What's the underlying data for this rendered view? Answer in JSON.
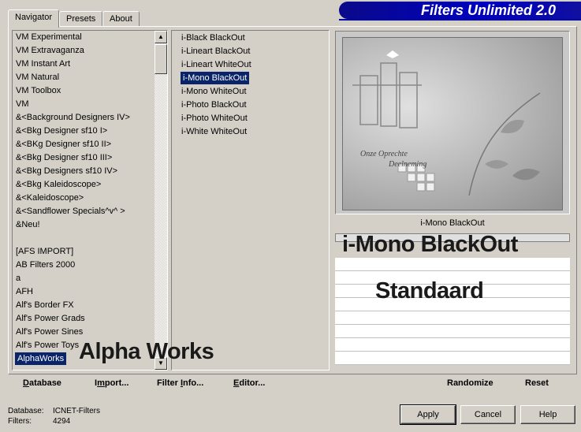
{
  "tabs": [
    {
      "label": "Navigator",
      "active": true
    },
    {
      "label": "Presets",
      "active": false
    },
    {
      "label": "About",
      "active": false
    }
  ],
  "app_title": "Filters Unlimited 2.0",
  "categories": [
    "VM Experimental",
    "VM Extravaganza",
    "VM Instant Art",
    "VM Natural",
    "VM Toolbox",
    "VM",
    "&<Background Designers IV>",
    "&<Bkg Designer sf10 I>",
    "&<BKg Designer sf10 II>",
    "&<Bkg Designer sf10 III>",
    "&<Bkg Designers sf10 IV>",
    "&<Bkg Kaleidoscope>",
    "&<Kaleidoscope>",
    "&<Sandflower Specials^v^ >",
    "&Neu!",
    "",
    "[AFS IMPORT]",
    "AB Filters 2000",
    "a",
    "AFH",
    "Alf's Border FX",
    "Alf's Power Grads",
    "Alf's Power Sines",
    "Alf's Power Toys",
    "AlphaWorks"
  ],
  "selected_category": "AlphaWorks",
  "filters": [
    "i-Black BlackOut",
    "i-Lineart BlackOut",
    "i-Lineart WhiteOut",
    "i-Mono BlackOut",
    "i-Mono WhiteOut",
    "i-Photo BlackOut",
    "i-Photo WhiteOut",
    "i-White WhiteOut"
  ],
  "selected_filter": "i-Mono BlackOut",
  "preview": {
    "caption": "i-Mono BlackOut",
    "image_text_1": "Onze Oprechte",
    "image_text_2": "Deelneming"
  },
  "overlays": {
    "filter_name": "i-Mono BlackOut",
    "preset": "Standaard",
    "category": "Alpha Works"
  },
  "toolbar": {
    "database_u": "D",
    "database_rest": "atabase",
    "import_pre": "I",
    "import_u": "m",
    "import_rest": "port...",
    "filterinfo_pre": "Filter ",
    "filterinfo_u": "I",
    "filterinfo_rest": "nfo...",
    "editor_u": "E",
    "editor_rest": "ditor...",
    "randomize": "Randomize",
    "reset": "Reset"
  },
  "status": {
    "database_label": "Database:",
    "database_value": "ICNET-Filters",
    "filters_label": "Filters:",
    "filters_value": "4294"
  },
  "buttons": {
    "apply": "Apply",
    "cancel": "Cancel",
    "help": "Help"
  }
}
